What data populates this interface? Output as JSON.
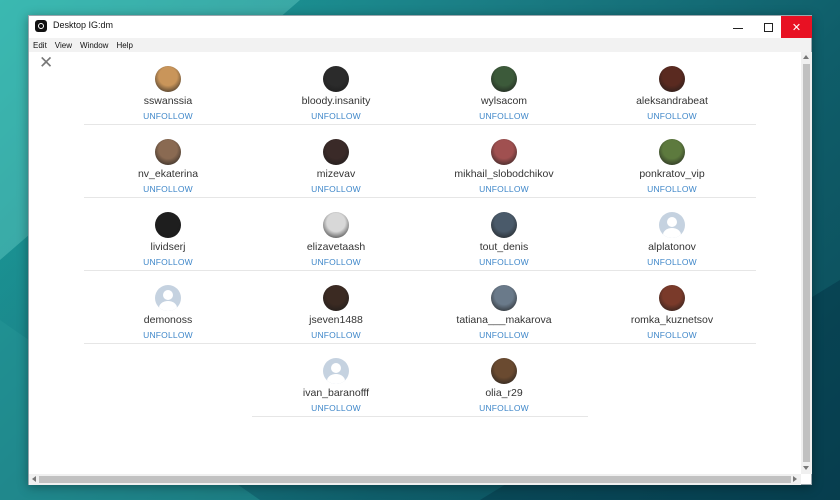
{
  "window": {
    "title": "Desktop IG:dm",
    "close_glyph": "✕",
    "minimize_icon": "minimize-icon",
    "maximize_icon": "maximize-icon"
  },
  "menu": [
    "Edit",
    "View",
    "Window",
    "Help"
  ],
  "panel": {
    "close_glyph": "✕"
  },
  "action_label": "UNFOLLOW",
  "colors": {
    "accent": "#3f87c9",
    "close_button": "#e81123",
    "placeholder_avatar": "#c5d2e0"
  },
  "rows": [
    [
      {
        "username": "sswanssia",
        "avatar": "photo",
        "color": "#c9955a"
      },
      {
        "username": "bloody.insanity",
        "avatar": "photo",
        "color": "#2b2b2b"
      },
      {
        "username": "wylsacom",
        "avatar": "photo",
        "color": "#3c5a3a"
      },
      {
        "username": "aleksandrabeat",
        "avatar": "photo",
        "color": "#5a2a20"
      }
    ],
    [
      {
        "username": "nv_ekaterina",
        "avatar": "photo",
        "color": "#8a6a52"
      },
      {
        "username": "mizevav",
        "avatar": "photo",
        "color": "#3a2a28"
      },
      {
        "username": "mikhail_slobodchikov",
        "avatar": "photo",
        "color": "#a05050"
      },
      {
        "username": "ponkratov_vip",
        "avatar": "photo",
        "color": "#5d7a3e"
      }
    ],
    [
      {
        "username": "lividserj",
        "avatar": "photo",
        "color": "#1e1e1e"
      },
      {
        "username": "elizavetaash",
        "avatar": "photo",
        "color": "#d8d8d8"
      },
      {
        "username": "tout_denis",
        "avatar": "photo",
        "color": "#4a5a6a"
      },
      {
        "username": "alplatonov",
        "avatar": "placeholder",
        "color": "#c5d2e0"
      }
    ],
    [
      {
        "username": "demonoss",
        "avatar": "placeholder",
        "color": "#c5d2e0"
      },
      {
        "username": "jseven1488",
        "avatar": "photo",
        "color": "#3b2a22"
      },
      {
        "username": "tatiana___makarova",
        "avatar": "photo",
        "color": "#6a7a8a"
      },
      {
        "username": "romka_kuznetsov",
        "avatar": "photo",
        "color": "#7a3a2a"
      }
    ],
    [
      {
        "username": "ivan_baranofff",
        "avatar": "placeholder",
        "color": "#c5d2e0"
      },
      {
        "username": "olia_r29",
        "avatar": "photo",
        "color": "#6a4a30"
      }
    ]
  ]
}
